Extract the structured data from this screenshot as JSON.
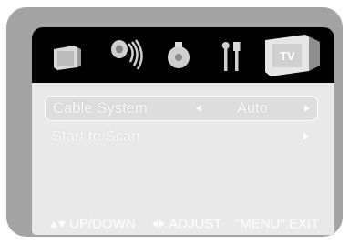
{
  "icons": [
    {
      "name": "picture-icon"
    },
    {
      "name": "sound-icon"
    },
    {
      "name": "features-icon"
    },
    {
      "name": "install-tools-icon"
    },
    {
      "name": "tv-channel-icon",
      "selected": true
    }
  ],
  "menu": {
    "items": [
      {
        "label": "Cable System",
        "value": "Auto",
        "selected": true
      },
      {
        "label": "Start to Scan",
        "value": "",
        "selected": false
      }
    ]
  },
  "help": {
    "updown": "UP/DOWN",
    "adjust": "ADJUST",
    "exit": "\"MENU\":EXIT"
  },
  "colors": {
    "frame": "#a3a3a3",
    "panel": "#e9e9e9",
    "header": "#000000",
    "text": "#ffffff"
  }
}
